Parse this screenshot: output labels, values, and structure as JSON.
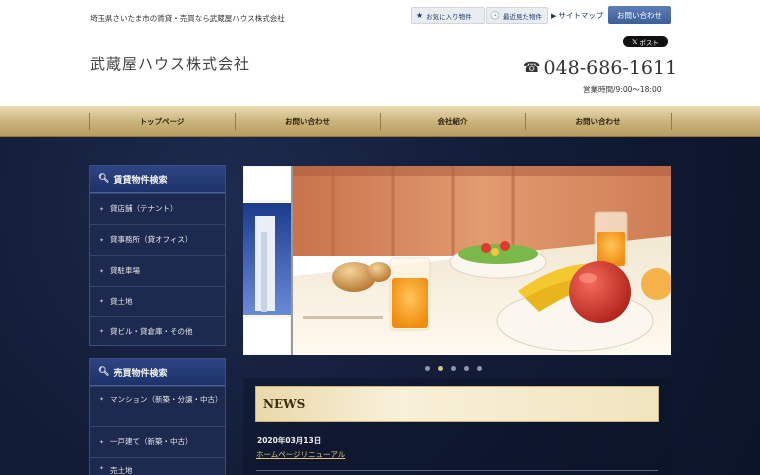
{
  "header": {
    "tagline": "埼玉県さいたま市の賃貸・売買なら武蔵屋ハウス株式会社",
    "logo": "武蔵屋ハウス株式会社",
    "favorites_label": "お気に入り物件",
    "recent_label": "最近見た物件",
    "sitemap_label": "サイトマップ",
    "contact_button": "お問い合わせ",
    "post_button": "ポスト",
    "phone": "048-686-1611",
    "hours": "営業時間/9:00～18:00"
  },
  "nav": {
    "items": [
      {
        "label": "トップページ"
      },
      {
        "label": "お問い合わせ"
      },
      {
        "label": "会社紹介"
      },
      {
        "label": "お問い合わせ"
      }
    ]
  },
  "sidebar": {
    "rental": {
      "title": "賃貸物件検索",
      "items": [
        {
          "label": "貸店舗（テナント）"
        },
        {
          "label": "貸事務所（貸オフィス）"
        },
        {
          "label": "貸駐車場"
        },
        {
          "label": "貸土地"
        },
        {
          "label": "貸ビル・貸倉庫・その他"
        }
      ]
    },
    "sale": {
      "title": "売買物件検索",
      "items": [
        {
          "label": "マンション（新築・分譲・中古）"
        },
        {
          "label": "一戸建て（新築・中古）"
        },
        {
          "label": "売土地"
        }
      ]
    }
  },
  "slider": {
    "slide_count": 5,
    "active_slide": 2
  },
  "news": {
    "heading": "NEWS",
    "entries": [
      {
        "date": "2020年03月13日",
        "title": "ホームページリニューアル"
      }
    ]
  },
  "colors": {
    "navy": "#131d38",
    "gold": "#c9b27a",
    "accent_blue": "#3c5f98",
    "link_gold": "#e4c87a"
  }
}
